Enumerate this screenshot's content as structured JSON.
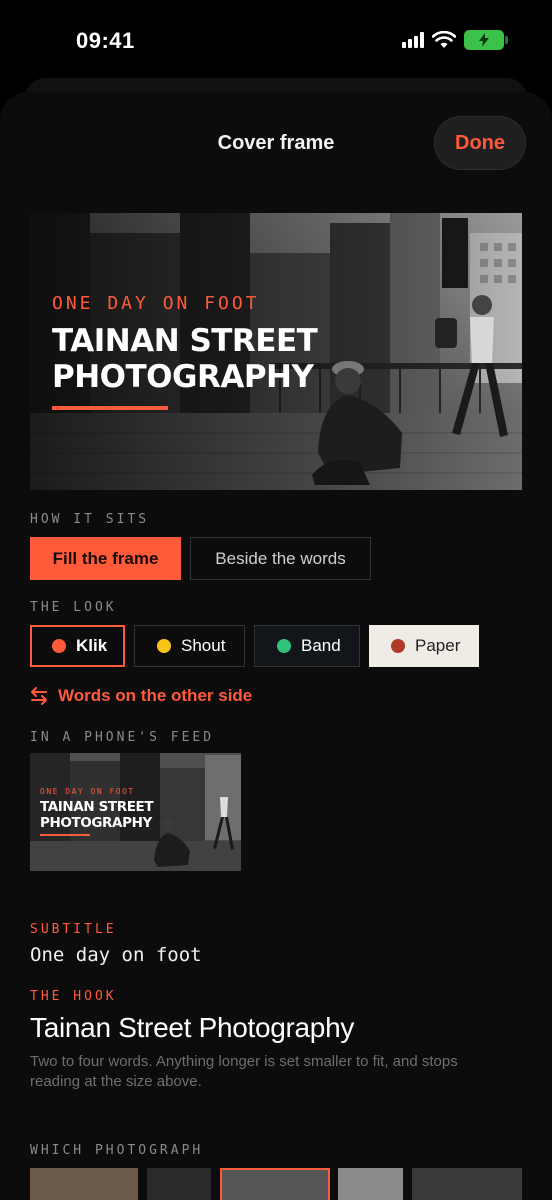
{
  "status_bar": {
    "time": "09:41"
  },
  "header": {
    "title": "Cover frame",
    "done_label": "Done"
  },
  "cover": {
    "eyebrow": "ONE DAY ON FOOT",
    "hook": "TAINAN STREET PHOTOGRAPHY"
  },
  "how_it_sits": {
    "label": "HOW IT SITS",
    "options": [
      "Fill the frame",
      "Beside the words"
    ],
    "selected": "Fill the frame"
  },
  "the_look": {
    "label": "THE LOOK",
    "options": [
      {
        "label": "Klik",
        "color": "#ff5a3a"
      },
      {
        "label": "Shout",
        "color": "#f5c518"
      },
      {
        "label": "Band",
        "color": "#2fc27a"
      },
      {
        "label": "Paper",
        "color": "#b0392a"
      }
    ],
    "selected": "Klik"
  },
  "swap": {
    "label": "Words on the other side"
  },
  "feed": {
    "label": "IN A PHONE'S FEED",
    "eyebrow": "ONE DAY ON FOOT",
    "hook": "TAINAN STREET PHOTOGRAPHY"
  },
  "fields": {
    "subtitle_label": "SUBTITLE",
    "subtitle_value": "One day on foot",
    "hook_label": "THE HOOK",
    "hook_value": "Tainan Street Photography",
    "hook_hint": "Two to four words. Anything longer is set smaller to fit, and stops reading at the size above."
  },
  "which_photograph": {
    "label": "WHICH PHOTOGRAPH",
    "selected_index": 2
  },
  "colors": {
    "accent": "#ff5a3a",
    "background": "#0c0c0d"
  }
}
